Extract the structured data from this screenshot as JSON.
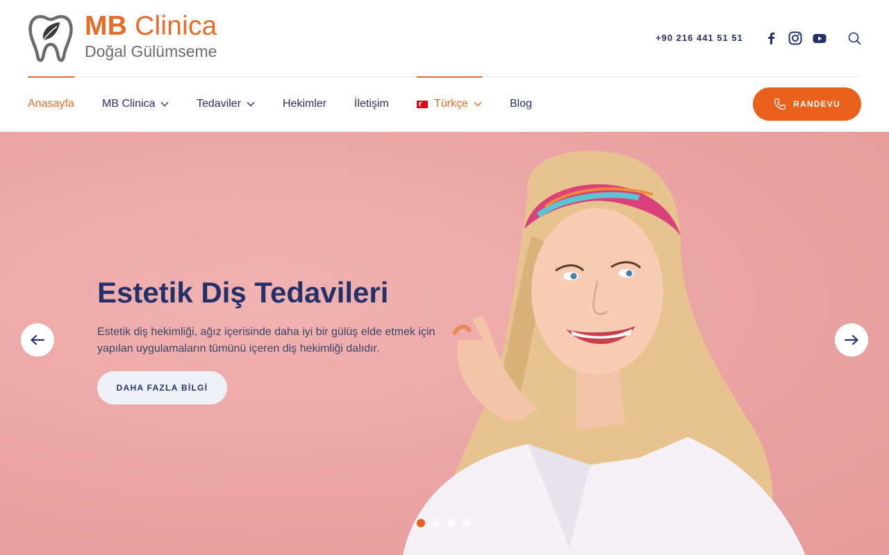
{
  "brand": {
    "name_bold": "MB",
    "name_rest": " Clinica",
    "tagline": "Doğal Gülümseme",
    "icon": "tooth-leaf-icon",
    "accent_color": "#e96b25",
    "primary_color": "#243168"
  },
  "header": {
    "phone": "+90 216 441 51 51",
    "social": [
      "facebook-icon",
      "instagram-icon",
      "youtube-icon"
    ],
    "search_icon": "search-icon"
  },
  "nav": {
    "items": [
      {
        "label": "Anasayfa",
        "active": true,
        "dropdown": false
      },
      {
        "label": "MB Clinica",
        "active": false,
        "dropdown": true
      },
      {
        "label": "Tedaviler",
        "active": false,
        "dropdown": true
      },
      {
        "label": "Hekimler",
        "active": false,
        "dropdown": false
      },
      {
        "label": "İletişim",
        "active": false,
        "dropdown": false
      },
      {
        "label": "Türkçe",
        "active": false,
        "dropdown": true,
        "flag": "turkey-flag-icon"
      },
      {
        "label": "Blog",
        "active": false,
        "dropdown": false
      }
    ],
    "cta_label": "RANDEVU",
    "cta_icon": "phone-icon"
  },
  "hero": {
    "title": "Estetik Diş Tedavileri",
    "text": "Estetik diş hekimliği, ağız içerisinde daha iyi bir gülüş elde etmek için yapılan uygulamaların tümünü içeren diş hekimliği dalıdır.",
    "button_label": "DAHA FAZLA BİLGİ",
    "prev_icon": "arrow-left-icon",
    "next_icon": "arrow-right-icon",
    "slide_count": 4,
    "active_slide": 1
  }
}
